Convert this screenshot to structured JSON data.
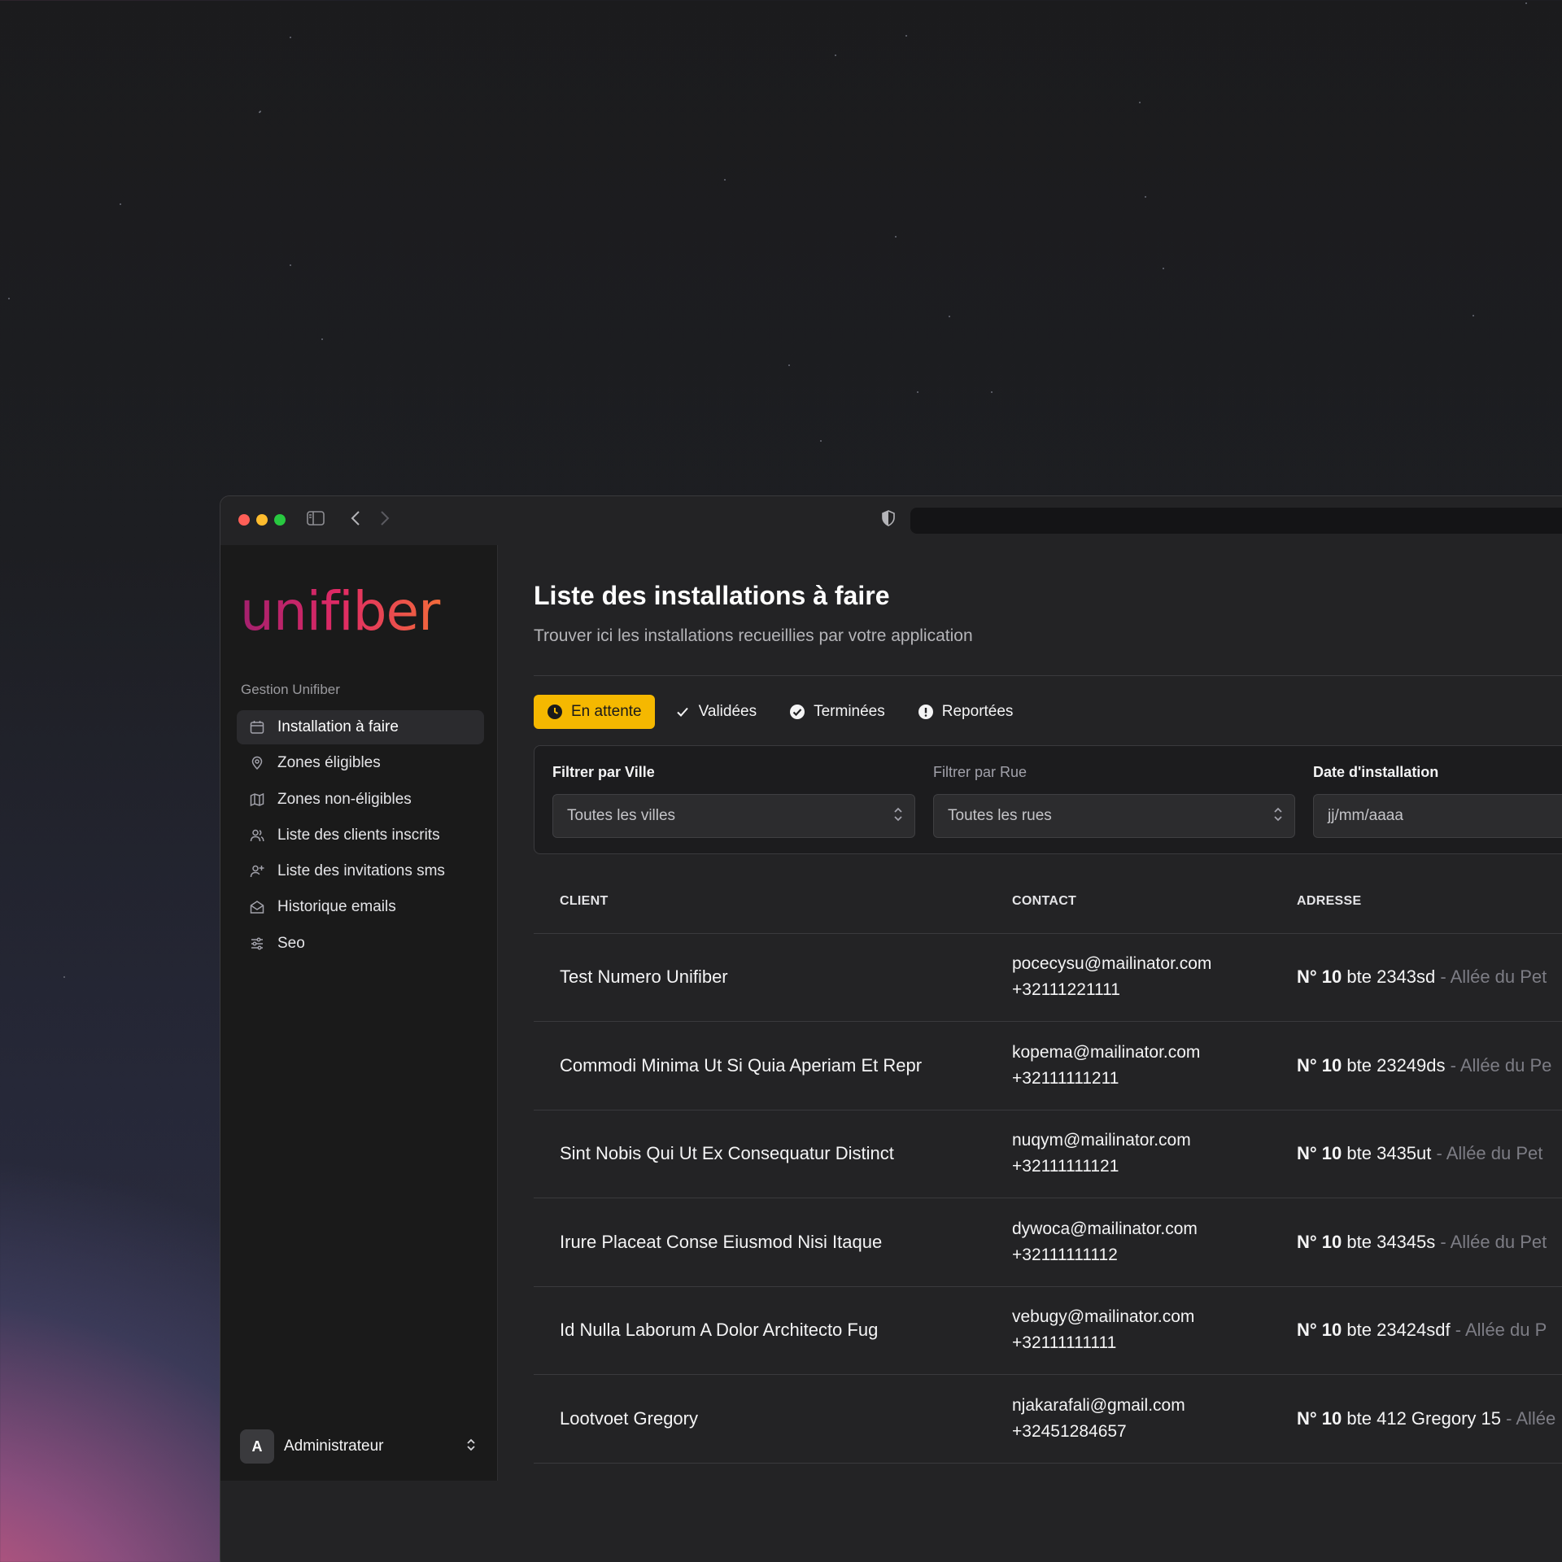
{
  "window": {
    "controls": {
      "close_color": "#ff5f57",
      "minimize_color": "#febc2e",
      "maximize_color": "#28c840"
    }
  },
  "brand": {
    "logo_text": "unifiber",
    "accent_gradient": [
      "#b4236d",
      "#e0306a",
      "#f06a3c"
    ]
  },
  "sidebar": {
    "section_label": "Gestion Unifiber",
    "items": [
      {
        "label": "Installation à faire",
        "icon": "calendar-icon",
        "active": true
      },
      {
        "label": "Zones éligibles",
        "icon": "map-pin-icon",
        "active": false
      },
      {
        "label": "Zones non-éligibles",
        "icon": "map-icon",
        "active": false
      },
      {
        "label": "Liste des clients inscrits",
        "icon": "users-icon",
        "active": false
      },
      {
        "label": "Liste des invitations sms",
        "icon": "user-plus-icon",
        "active": false
      },
      {
        "label": "Historique emails",
        "icon": "mail-open-icon",
        "active": false
      },
      {
        "label": "Seo",
        "icon": "sliders-icon",
        "active": false
      }
    ],
    "user": {
      "avatar_letter": "A",
      "name": "Administrateur"
    }
  },
  "header": {
    "title": "Liste des installations à faire",
    "subtitle": "Trouver ici les installations recueillies par votre application"
  },
  "tabs": [
    {
      "label": "En attente",
      "icon": "clock-icon",
      "active": true
    },
    {
      "label": "Validées",
      "icon": "check-icon",
      "active": false
    },
    {
      "label": "Terminées",
      "icon": "check-circle-icon",
      "active": false
    },
    {
      "label": "Reportées",
      "icon": "alert-circle-icon",
      "active": false
    }
  ],
  "filters": {
    "city": {
      "label": "Filtrer par Ville",
      "value": "Toutes les villes"
    },
    "street": {
      "label": "Filtrer par Rue",
      "value": "Toutes les rues"
    },
    "date": {
      "label": "Date d'installation",
      "placeholder": "jj/mm/aaaa"
    }
  },
  "table": {
    "headers": [
      "CLIENT",
      "CONTACT",
      "ADRESSE"
    ],
    "rows": [
      {
        "client": "Test Numero Unifiber",
        "email": "pocecysu@mailinator.com",
        "phone": "+32111221111",
        "num": "N° 10",
        "box": "bte 2343sd",
        "street": "- Allée du Pet"
      },
      {
        "client": "Commodi Minima Ut Si Quia Aperiam Et Repr",
        "email": "kopema@mailinator.com",
        "phone": "+32111111211",
        "num": "N° 10",
        "box": "bte 23249ds",
        "street": "- Allée du Pe"
      },
      {
        "client": "Sint Nobis Qui Ut Ex Consequatur Distinct",
        "email": "nuqym@mailinator.com",
        "phone": "+32111111121",
        "num": "N° 10",
        "box": "bte 3435ut",
        "street": "- Allée du Pet"
      },
      {
        "client": "Irure Placeat Conse Eiusmod Nisi Itaque",
        "email": "dywoca@mailinator.com",
        "phone": "+32111111112",
        "num": "N° 10",
        "box": "bte 34345s",
        "street": "- Allée du Pet"
      },
      {
        "client": "Id Nulla Laborum A Dolor Architecto Fug",
        "email": "vebugy@mailinator.com",
        "phone": "+32111111111",
        "num": "N° 10",
        "box": "bte 23424sdf",
        "street": "- Allée du P"
      },
      {
        "client": "Lootvoet Gregory",
        "email": "njakarafali@gmail.com",
        "phone": "+32451284657",
        "num": "N° 10",
        "box": "bte 412 Gregory 15",
        "street": "- Allée"
      }
    ]
  },
  "colors": {
    "accent_yellow": "#f5b800",
    "sidebar_bg": "#1a1a1a",
    "main_bg": "#232325"
  }
}
